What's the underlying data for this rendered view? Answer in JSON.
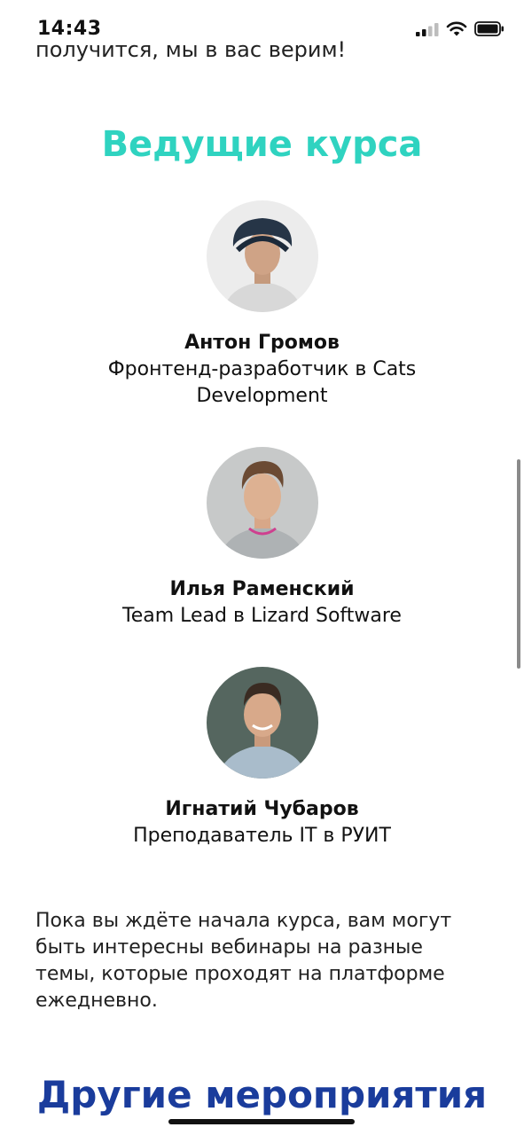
{
  "status_bar": {
    "time": "14:43"
  },
  "intro": {
    "tail_text": "получится, мы в вас верим!"
  },
  "section": {
    "title": "Ведущие курса",
    "title_color": "#2fd3c0"
  },
  "speakers": [
    {
      "name": "Антон Громов",
      "role": "Фронтенд-разработчик в Cats Development"
    },
    {
      "name": "Илья Раменский",
      "role": "Team Lead в Lizard Software"
    },
    {
      "name": "Игнатий Чубаров",
      "role": "Преподаватель IT в РУИТ"
    }
  ],
  "paragraph": "Пока вы ждёте начала курса, вам могут быть интересны вебинары на разные темы, которые проходят на платформе ежедневно.",
  "events": {
    "title": "Другие мероприятия",
    "title_color": "#1a3c9c"
  }
}
